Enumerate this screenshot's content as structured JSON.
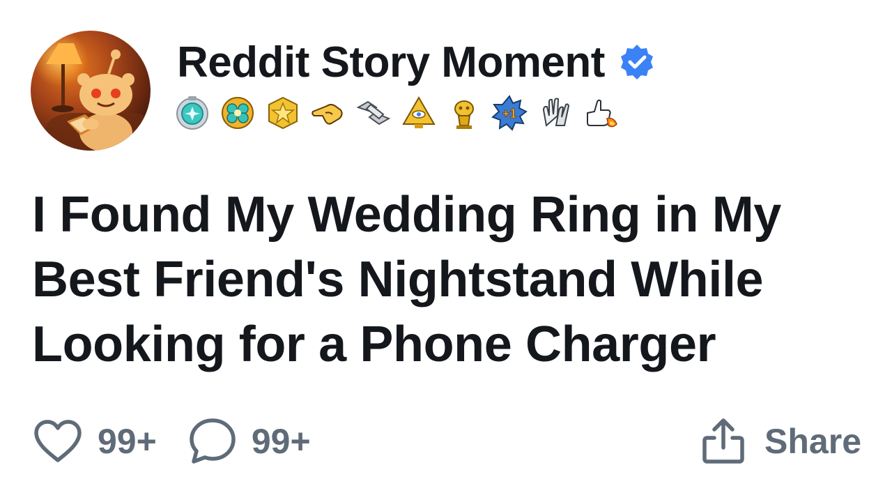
{
  "header": {
    "author_name": "Reddit Story Moment",
    "verified_icon": "verified-badge-icon",
    "avatar_icon": "snoo-reading-avatar",
    "awards": [
      "silver-medal-award-icon",
      "gold-cluster-award-icon",
      "gold-star-award-icon",
      "pointing-hand-award-icon",
      "handshake-award-icon",
      "pyramid-eye-award-icon",
      "trophy-snoo-award-icon",
      "plus-one-award-icon",
      "clapping-hands-award-icon",
      "rocket-thumbs-up-award-icon"
    ]
  },
  "post": {
    "title": "I Found My Wedding Ring in My Best Friend's Nightstand While Looking for a Phone Charger"
  },
  "actions": {
    "like_count": "99+",
    "comment_count": "99+",
    "share_label": "Share"
  },
  "colors": {
    "text": "#14171c",
    "muted": "#5f6b78",
    "verified": "#3b82f6",
    "avatar_bg": "#7a3412"
  }
}
